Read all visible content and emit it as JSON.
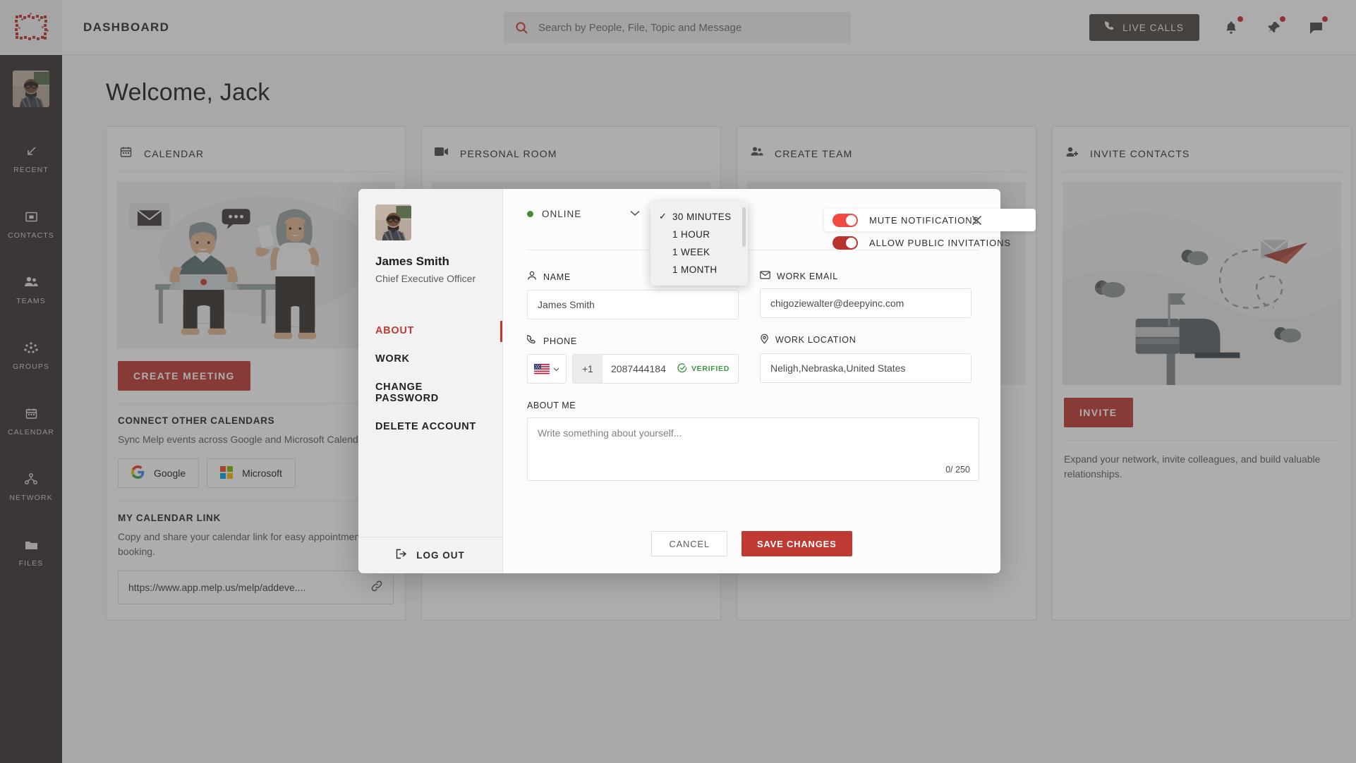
{
  "sidebar": {
    "logo_name": "melp-logo",
    "avatar_name": "user-avatar",
    "items": [
      {
        "label": "RECENT",
        "icon": "arrow-down-left-icon"
      },
      {
        "label": "CONTACTS",
        "icon": "contact-card-icon"
      },
      {
        "label": "TEAMS",
        "icon": "people-icon"
      },
      {
        "label": "GROUPS",
        "icon": "network-dots-icon"
      },
      {
        "label": "CALENDAR",
        "icon": "calendar-icon"
      },
      {
        "label": "NETWORK",
        "icon": "sitemap-icon"
      },
      {
        "label": "FILES",
        "icon": "folder-icon"
      }
    ]
  },
  "header": {
    "title": "DASHBOARD",
    "search_placeholder": "Search by People, File, Topic and Message",
    "search_value": "",
    "live_calls_label": "LIVE CALLS",
    "icons": [
      "bell-icon",
      "pin-icon",
      "chat-icon"
    ]
  },
  "main": {
    "welcome": "Welcome, Jack",
    "cards": [
      {
        "title": "CALENDAR",
        "icon": "calendar-icon",
        "primary_button": "CREATE MEETING",
        "section1_title": "CONNECT OTHER CALENDARS",
        "section1_desc": "Sync Melp events across Google and Microsoft Calendars.",
        "providers": [
          "Google",
          "Microsoft"
        ],
        "section2_title": "MY CALENDAR LINK",
        "section2_desc": "Copy and share your calendar link for easy appointment booking.",
        "link_value": "https://www.app.melp.us/melp/addeve...."
      },
      {
        "title": "PERSONAL ROOM",
        "icon": "video-camera-icon"
      },
      {
        "title": "CREATE TEAM",
        "icon": "people-icon"
      },
      {
        "title": "INVITE CONTACTS",
        "icon": "add-person-icon",
        "primary_button": "INVITE",
        "note": "Expand your network, invite colleagues, and build valuable relationships."
      }
    ]
  },
  "modal": {
    "profile": {
      "name": "James Smith",
      "role": "Chief Executive Officer",
      "avatar_name": "profile-avatar"
    },
    "menu": [
      {
        "label": "ABOUT",
        "active": true
      },
      {
        "label": "WORK",
        "active": false
      },
      {
        "label": "CHANGE PASSWORD",
        "active": false
      },
      {
        "label": "DELETE ACCOUNT",
        "active": false
      }
    ],
    "logout_label": "LOG OUT",
    "status": {
      "label": "ONLINE",
      "color": "#3f8f2f"
    },
    "toggles": [
      {
        "label": "MUTE NOTIFICATIONS",
        "on": true,
        "hovered": true
      },
      {
        "label": "ALLOW PUBLIC INVITATIONS",
        "on": true,
        "hovered": false
      }
    ],
    "fields": {
      "name_label": "NAME",
      "name_value": "James Smith",
      "email_label": "WORK EMAIL",
      "email_value": "chigoziewalter@deepyinc.com",
      "phone_label": "PHONE",
      "phone_country_code": "+1",
      "phone_value": "2087444184",
      "phone_verified_label": "VERIFIED",
      "location_label": "WORK LOCATION",
      "location_value": "Neligh,Nebraska,United States",
      "about_label": "ABOUT ME",
      "about_placeholder": "Write something about yourself...",
      "about_count": "0/ 250"
    },
    "cancel_label": "CANCEL",
    "save_label": "SAVE CHANGES",
    "close_icon": "close-icon"
  },
  "dropdown": {
    "options": [
      {
        "label": "30 MINUTES",
        "selected": true
      },
      {
        "label": "1 HOUR",
        "selected": false
      },
      {
        "label": "1 WEEK",
        "selected": false
      },
      {
        "label": "1 MONTH",
        "selected": false
      }
    ]
  },
  "colors": {
    "brand_red": "#c03a34",
    "sidebar_bg": "#3b3533",
    "toggle_on": "#f04a42",
    "verified_green": "#39993c",
    "status_green": "#3f8f2f"
  }
}
